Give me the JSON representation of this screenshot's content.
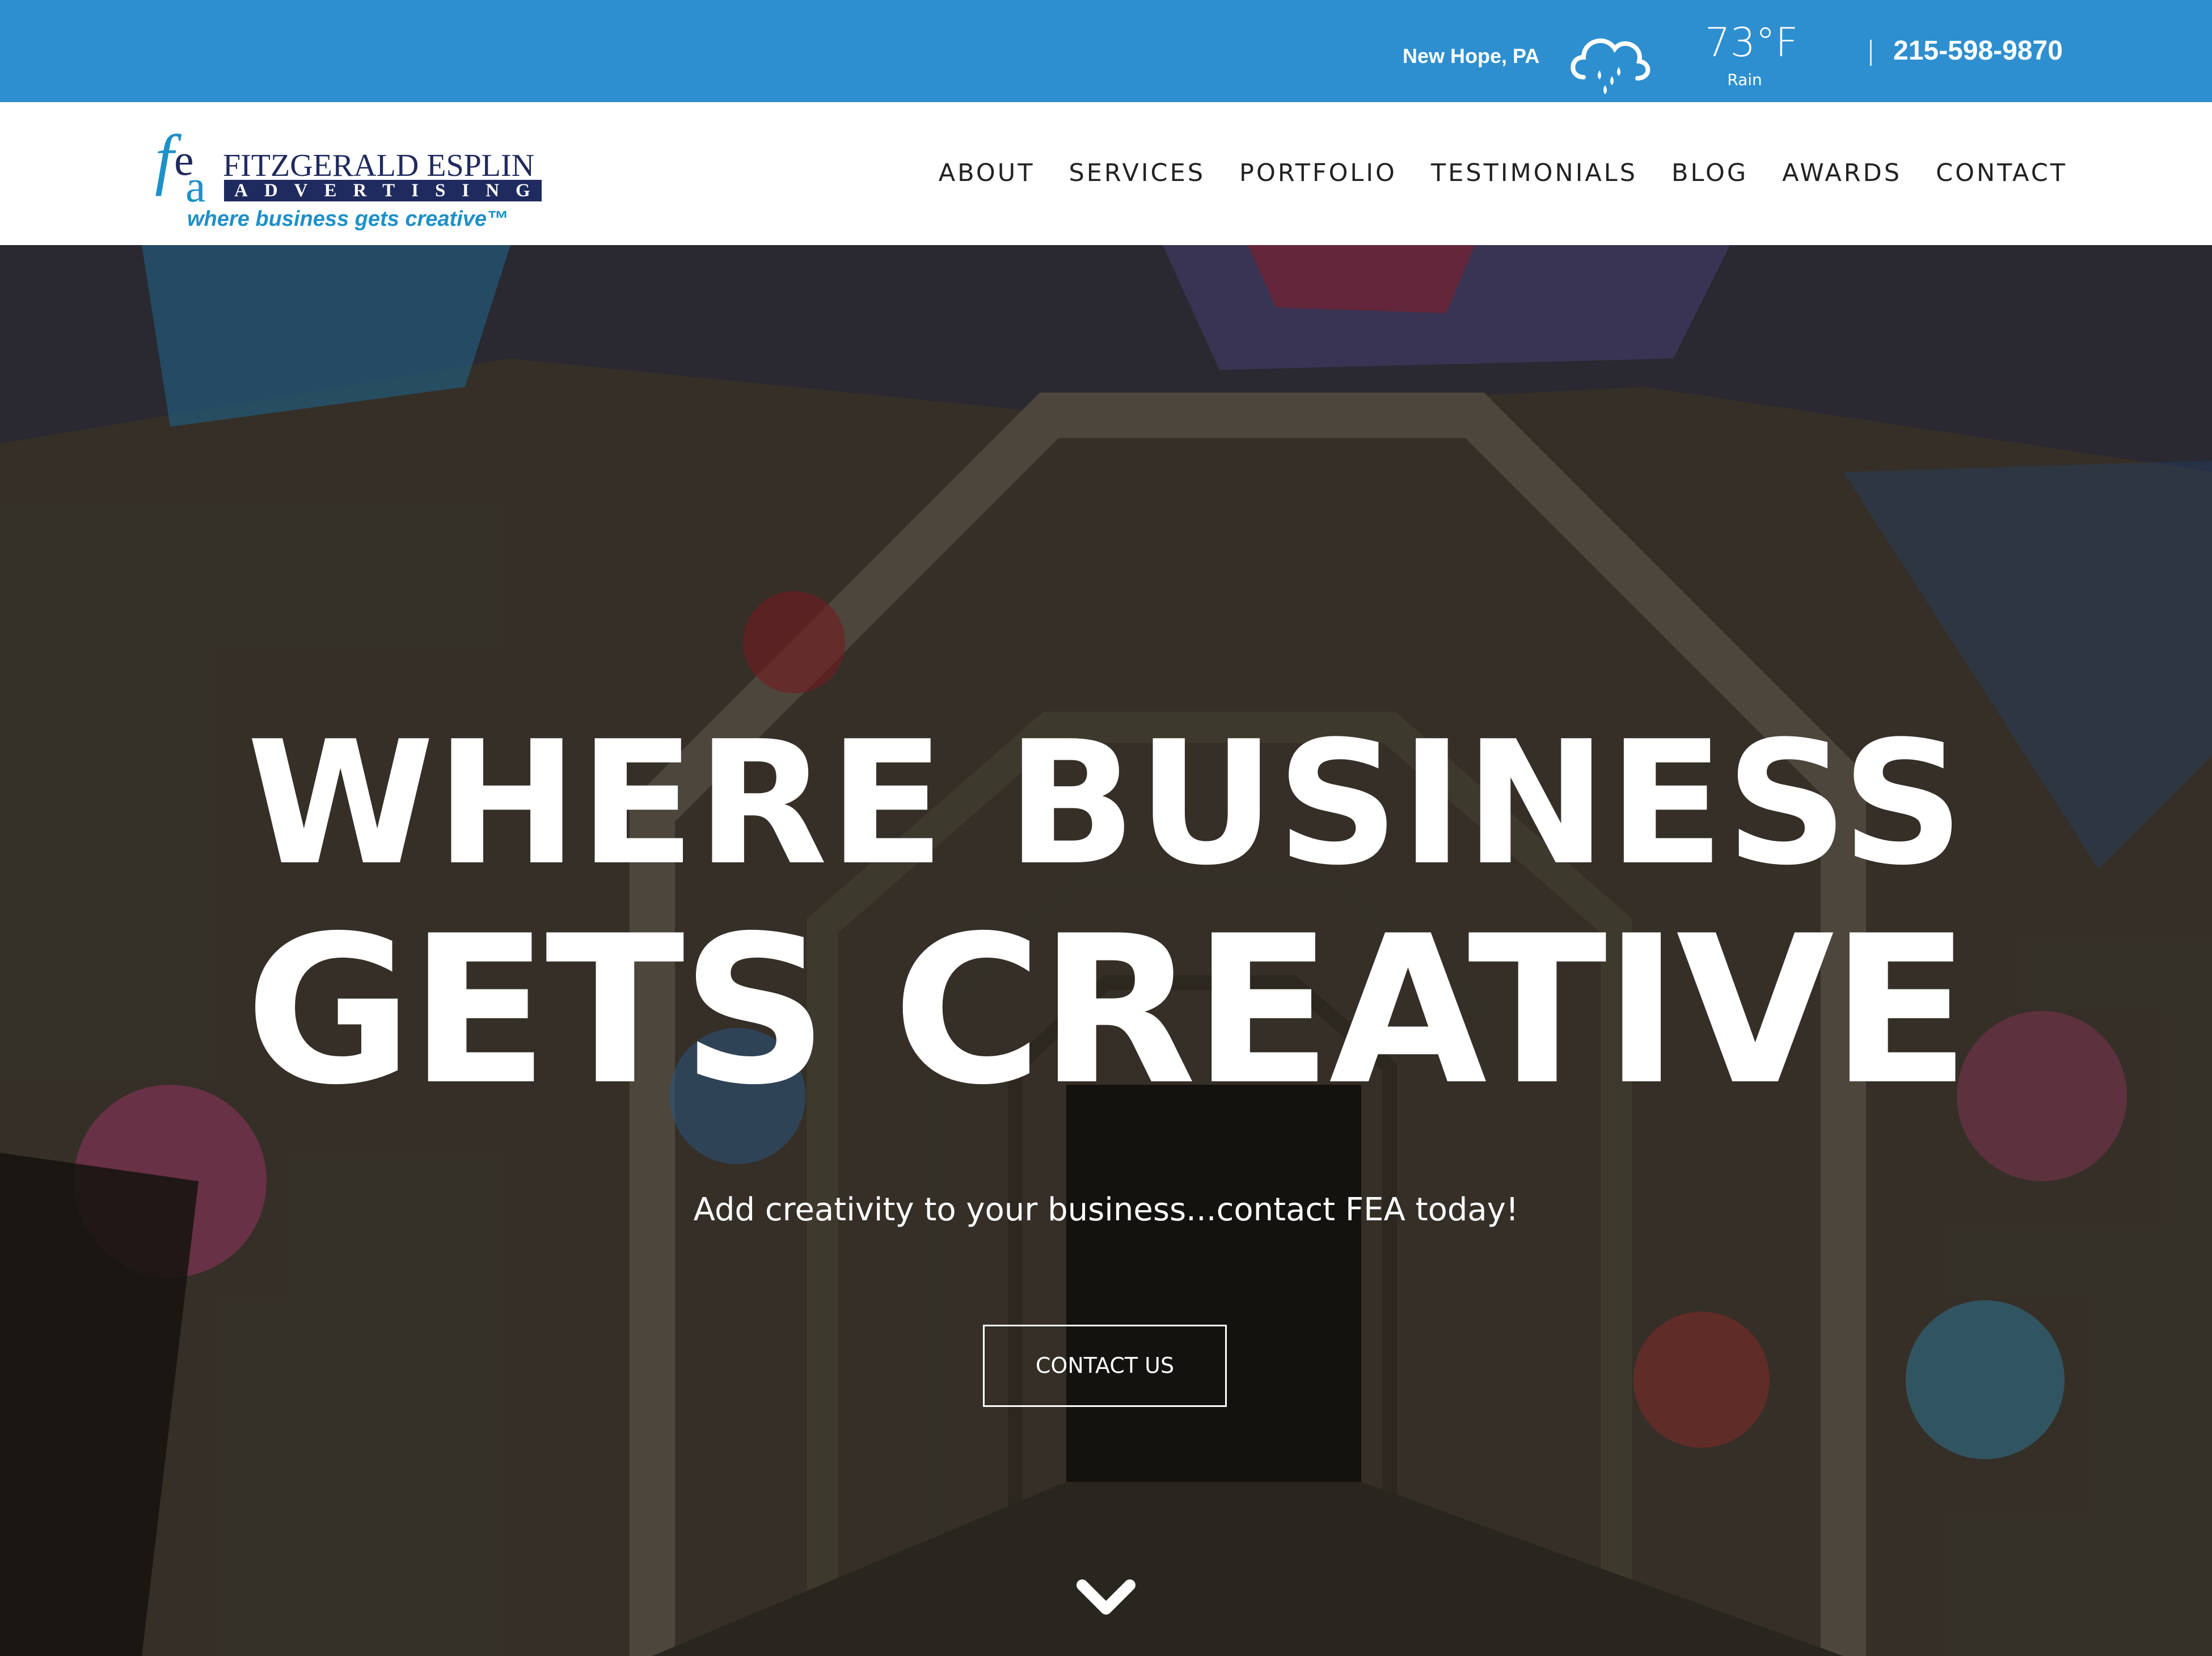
{
  "topbar": {
    "location": "New Hope, PA",
    "weather_icon": "rain-cloud-icon",
    "temperature": "73°F",
    "condition": "Rain",
    "phone": "215-598-9870",
    "background_color": "#2e8fd0"
  },
  "logo": {
    "mark": "fea",
    "company_name": "FITZGERALD ESPLIN",
    "company_sub": "ADVERTISING",
    "tagline": "where business gets creative™",
    "brand_color": "#1f2a5e",
    "accent_color": "#1e90c8"
  },
  "nav": {
    "items": [
      {
        "label": "ABOUT"
      },
      {
        "label": "SERVICES"
      },
      {
        "label": "PORTFOLIO"
      },
      {
        "label": "TESTIMONIALS"
      },
      {
        "label": "BLOG"
      },
      {
        "label": "AWARDS"
      },
      {
        "label": "CONTACT"
      }
    ]
  },
  "hero": {
    "headline_line1": "WHERE BUSINESS",
    "headline_line2": "GETS CREATIVE",
    "subheadline": "Add creativity to your business...contact FEA today!",
    "cta_label": "CONTACT US",
    "scroll_icon": "chevron-down-icon",
    "background": "graffiti tunnel photo"
  }
}
